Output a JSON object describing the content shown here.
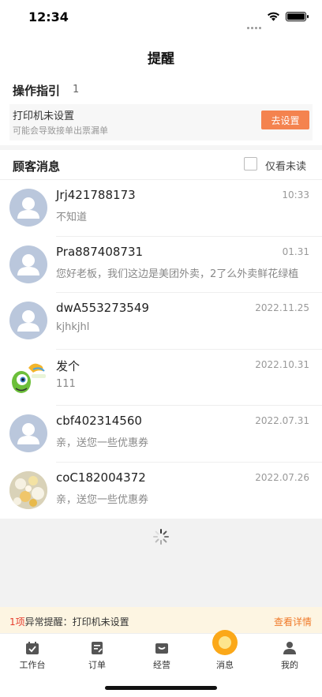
{
  "status_bar": {
    "time": "12:34"
  },
  "nav": {
    "title": "提醒"
  },
  "guide": {
    "title": "操作指引",
    "count": "1",
    "item_title": "打印机未设置",
    "item_sub": "可能会导致接单出票漏单",
    "button_label": "去设置",
    "button_color": "#f4834f"
  },
  "messages": {
    "title": "顾客消息",
    "unread_label": "仅看未读",
    "items": [
      {
        "name": "Jrj421788173",
        "time": "10:33",
        "preview": "不知道",
        "avatar": "default-avatar-icon"
      },
      {
        "name": "Pra887408731",
        "time": "01.31",
        "preview": "您好老板，我们这边是美团外卖，2了么外卖鲜花绿植",
        "avatar": "default-avatar-icon"
      },
      {
        "name": "dwA553273549",
        "time": "2022.11.25",
        "preview": "kjhkjhl",
        "avatar": "default-avatar-icon"
      },
      {
        "name": "发个",
        "time": "2022.10.31",
        "preview": "111",
        "avatar": "cartoon-monster-avatar"
      },
      {
        "name": "cbf402314560",
        "time": "2022.07.31",
        "preview": "亲，送您一些优惠券",
        "avatar": "default-avatar-icon"
      },
      {
        "name": "coC182004372",
        "time": "2022.07.26",
        "preview": "亲，送您一些优惠券",
        "avatar": "food-photo-avatar"
      }
    ]
  },
  "alert": {
    "count": "1项",
    "text": "异常提醒：打印机未设置",
    "detail": "查看详情"
  },
  "tabs": [
    {
      "label": "工作台",
      "icon": "workbench-icon"
    },
    {
      "label": "订单",
      "icon": "order-icon"
    },
    {
      "label": "经营",
      "icon": "business-icon"
    },
    {
      "label": "消息",
      "icon": "message-icon",
      "active": true
    },
    {
      "label": "我的",
      "icon": "profile-icon"
    }
  ],
  "colors": {
    "accent": "#f4834f",
    "alert_bg": "#fdf5e2",
    "avatar_default": "#bac7dc",
    "tab_active": "#fba819"
  }
}
